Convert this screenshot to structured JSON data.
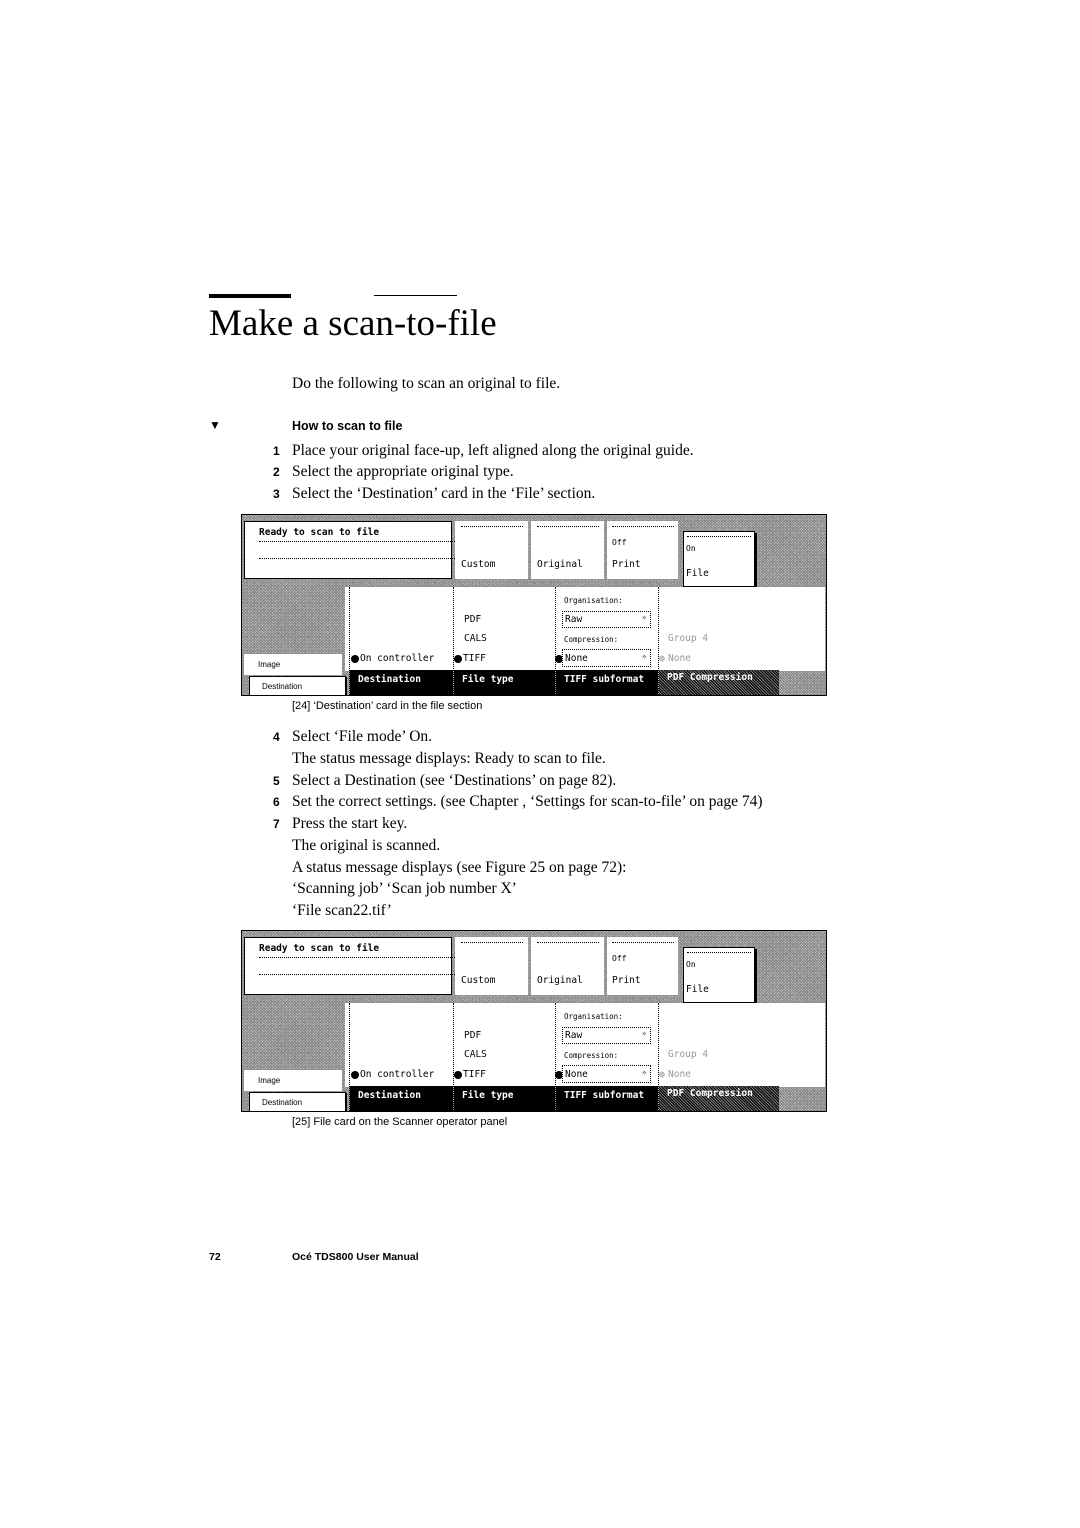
{
  "page": {
    "title": "Make a scan-to-file",
    "intro": "Do the following to scan an original to file.",
    "procedure_marker": "▼",
    "procedure_title": "How to scan to file",
    "steps_a": [
      {
        "num": "1",
        "text": "Place your original face-up, left aligned along the original guide."
      },
      {
        "num": "2",
        "text": "Select the appropriate original type."
      },
      {
        "num": "3",
        "text": "Select the ‘Destination’ card in the ‘File’ section."
      }
    ],
    "steps_b": [
      {
        "num": "4",
        "text": "Select ‘File mode’ On."
      },
      {
        "num": "",
        "text": "The status message displays: Ready to scan to file."
      },
      {
        "num": "5",
        "text": "Select a Destination (see ‘Destinations’ on page 82)."
      },
      {
        "num": "6",
        "text": "Set the correct settings. (see Chapter , ‘Settings for scan-to-file’ on page 74)"
      },
      {
        "num": "7",
        "text": "Press the start key."
      },
      {
        "num": "",
        "text": "The original is scanned."
      },
      {
        "num": "",
        "text": "A status message displays (see Figure 25 on page 72):"
      },
      {
        "num": "",
        "text": "‘Scanning job’ ‘Scan job number X’"
      },
      {
        "num": "",
        "text": "‘File scan22.tif’"
      }
    ],
    "footer": {
      "page_number": "72",
      "manual": "Océ TDS800 User Manual"
    }
  },
  "figures": [
    {
      "caption": "[24] ‘Destination’ card in the file section",
      "panel": {
        "status": "Ready to scan to file",
        "mode_custom": "Custom",
        "mode_original": "Original",
        "print_state": "Off",
        "print_label": "Print",
        "file_state": "On",
        "file_label": "File",
        "left_tab_image": "Image",
        "left_tab_destination": "Destination",
        "destination_value": "On controller",
        "filetype_options": [
          "PDF",
          "CALS",
          "TIFF"
        ],
        "organisation_label": "Organisation:",
        "organisation_value": "Raw",
        "compression_label": "Compression:",
        "compression_value": "None",
        "pdf_options": [
          "Group 4",
          "None"
        ],
        "tabs": [
          "Destination",
          "File type",
          "TIFF subformat",
          "PDF Compression"
        ]
      }
    },
    {
      "caption": "[25] File card on the Scanner operator panel",
      "panel": {
        "status": "Ready to scan to file",
        "mode_custom": "Custom",
        "mode_original": "Original",
        "print_state": "Off",
        "print_label": "Print",
        "file_state": "On",
        "file_label": "File",
        "left_tab_image": "Image",
        "left_tab_destination": "Destination",
        "destination_value": "On controller",
        "filetype_options": [
          "PDF",
          "CALS",
          "TIFF"
        ],
        "organisation_label": "Organisation:",
        "organisation_value": "Raw",
        "compression_label": "Compression:",
        "compression_value": "None",
        "pdf_options": [
          "Group 4",
          "None"
        ],
        "tabs": [
          "Destination",
          "File type",
          "TIFF subformat",
          "PDF Compression"
        ]
      }
    }
  ]
}
